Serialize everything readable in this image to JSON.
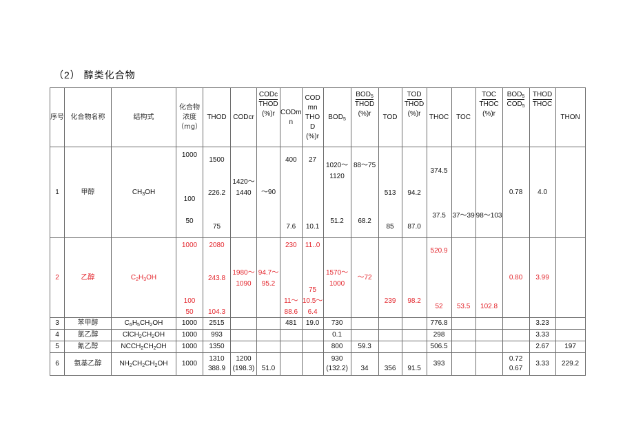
{
  "section_title": "（2） 醇类化合物",
  "headers": {
    "seq": "序号",
    "name": "化合物名称",
    "formula": "结构式",
    "conc": [
      "化合物",
      "浓度",
      "（mg）"
    ],
    "thod": "THOD",
    "codcr": "CODcr",
    "codc_thod": [
      "CODc",
      "THOD",
      "(%)r"
    ],
    "codmn": [
      "CODm",
      "n"
    ],
    "codmn_thod": [
      "COD",
      "mn",
      "THO",
      "D",
      "(%)r"
    ],
    "bod5": "BOD5",
    "bod5_thod": [
      "BOD5",
      "THOD",
      "(%)r"
    ],
    "tod": "TOD",
    "tod_thod": [
      "TOD",
      "THOD",
      "(%)r"
    ],
    "thoc": "THOC",
    "toc": "TOC",
    "toc_thoc": [
      "TOC",
      "THOC",
      "(%)r"
    ],
    "bod5_cod5": [
      "BOD5",
      "COD5"
    ],
    "thod_thoc": [
      "THOD",
      "THOC"
    ],
    "thon": "THON"
  },
  "rows": [
    {
      "seq": "1",
      "name": "甲醇",
      "formula": "CH3OH",
      "conc": [
        "1000",
        "100",
        "50"
      ],
      "thod": [
        "1500",
        "226.2",
        "75"
      ],
      "codcr": [
        "1420～",
        "1440"
      ],
      "codc_thod": "～90",
      "codmn": [
        "400",
        "7.6"
      ],
      "codmn_thod": [
        "27",
        "10.1"
      ],
      "bod5": [
        "1020～",
        "1120",
        "51.2"
      ],
      "bod5_thod": [
        "88～75",
        "68.2"
      ],
      "tod": [
        "513",
        "85"
      ],
      "tod_thod": [
        "94.2",
        "87.0"
      ],
      "thoc": [
        "374.5",
        "37.5"
      ],
      "toc": "37～39",
      "toc_thoc": "98～103",
      "bod5_cod5": "0.78",
      "thod_thoc": "4.0",
      "thon": ""
    },
    {
      "seq": "2",
      "name": "乙醇",
      "formula": "C2H3OH",
      "highlight_color": "#e3242b",
      "conc": [
        "1000",
        "100",
        "50"
      ],
      "thod": [
        "2080",
        "243.8",
        "104.3"
      ],
      "codcr": [
        "1980～",
        "1090"
      ],
      "codc_thod": [
        "94.7～",
        "95.2"
      ],
      "codmn": [
        "230",
        "11～",
        "88.6"
      ],
      "codmn_thod": [
        "11..0",
        "75",
        "10.5～",
        "6.4"
      ],
      "bod5": [
        "1570～",
        "1000"
      ],
      "bod5_thod": "～72",
      "tod": "239",
      "tod_thod": "98.2",
      "thoc": [
        "520.9",
        "52"
      ],
      "toc": "53.5",
      "toc_thoc": "102.8",
      "bod5_cod5": "0.80",
      "thod_thoc": "3.99",
      "thon": ""
    },
    {
      "seq": "3",
      "name": "苯甲醇",
      "formula": "C6H5CH2OH",
      "conc": "1000",
      "thod": "2515",
      "codmn": "481",
      "codmn_thod": "19.0",
      "bod5": "730",
      "thoc": "776.8",
      "thod_thoc": "3.23"
    },
    {
      "seq": "4",
      "name": "氯乙醇",
      "formula": "ClCH2CH2OH",
      "conc": "1000",
      "thod": "993",
      "bod5": "0.1",
      "thoc": "298",
      "thod_thoc": "3.33"
    },
    {
      "seq": "5",
      "name": "氰乙醇",
      "formula": "NCCH2CH2OH",
      "conc": "1000",
      "thod": "1350",
      "bod5": "800",
      "bod5_thod": "59.3",
      "thoc": "506.5",
      "thod_thoc": "2.67",
      "thon": "197"
    },
    {
      "seq": "6",
      "name": "氨基乙醇",
      "formula": "NH2CH2CH2OH",
      "conc": "1000",
      "thod": [
        "1310",
        "388.9"
      ],
      "codcr": [
        "1200",
        "(198.3)"
      ],
      "codc_thod": "51.0",
      "bod5": [
        "930",
        "(132.2)"
      ],
      "bod5_thod": "34",
      "tod": "356",
      "tod_thod": "91.5",
      "thoc": "393",
      "bod5_cod5": [
        "0.72",
        "0.67"
      ],
      "thod_thoc": "3.33",
      "thon": "229.2"
    }
  ]
}
